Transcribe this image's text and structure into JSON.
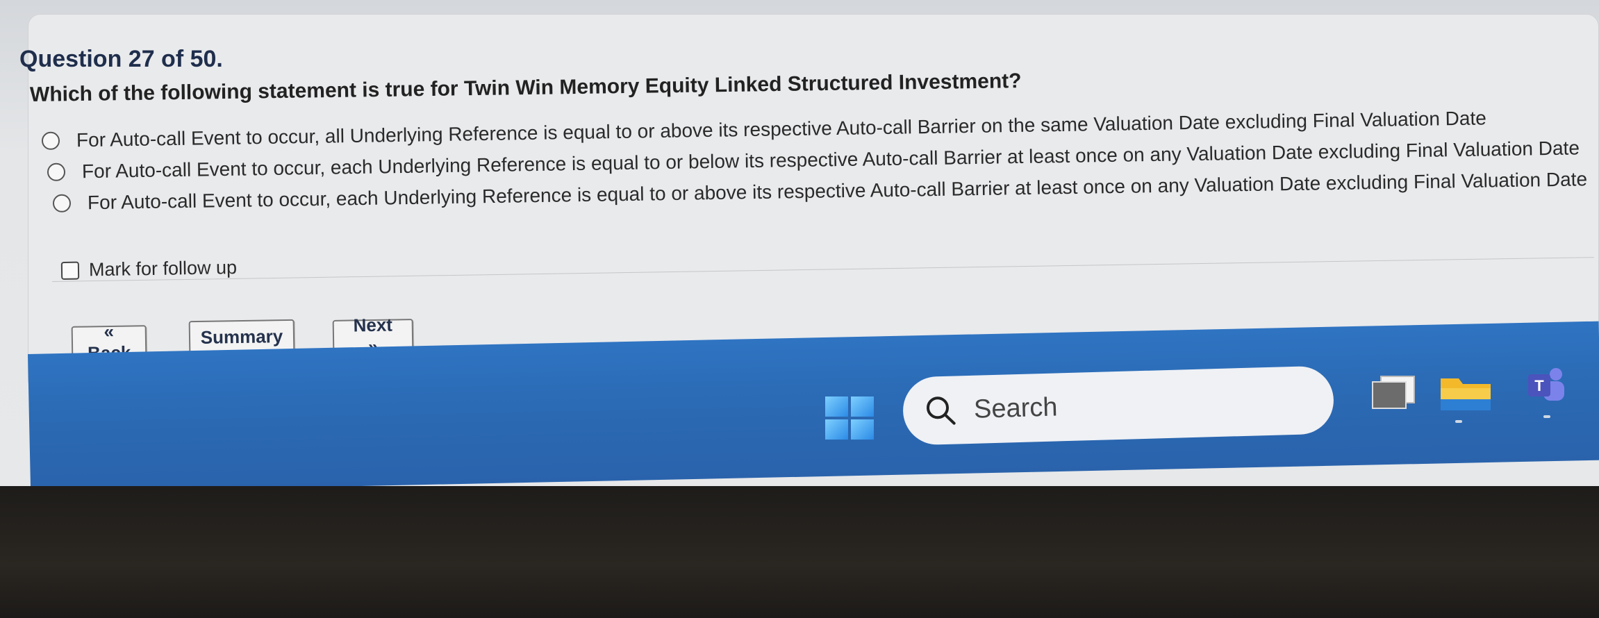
{
  "quiz": {
    "question_number": "Question 27 of 50.",
    "question_text": "Which of the following statement is true for Twin Win Memory Equity Linked Structured Investment?",
    "options": [
      "For Auto-call Event to occur, all Underlying Reference is equal to or above its respective Auto-call Barrier on the same Valuation Date excluding Final Valuation Date",
      "For Auto-call Event to occur, each Underlying Reference is equal to or below its respective Auto-call Barrier at least once on any Valuation Date excluding Final Valuation Date",
      "For Auto-call Event to occur, each Underlying Reference is equal to or above its respective Auto-call Barrier at least once on any Valuation Date excluding Final Valuation Date"
    ],
    "follow_up_label": "Mark for follow up",
    "buttons": {
      "back": "« Back",
      "summary": "Summary",
      "next": "Next »"
    }
  },
  "taskbar": {
    "search_label": "Search",
    "icons": [
      "windows-start-icon",
      "search-icon",
      "task-view-icon",
      "file-explorer-icon",
      "teams-icon"
    ],
    "colors": {
      "taskbar": "#2b6ab4",
      "search_box": "#eff1f5"
    }
  }
}
